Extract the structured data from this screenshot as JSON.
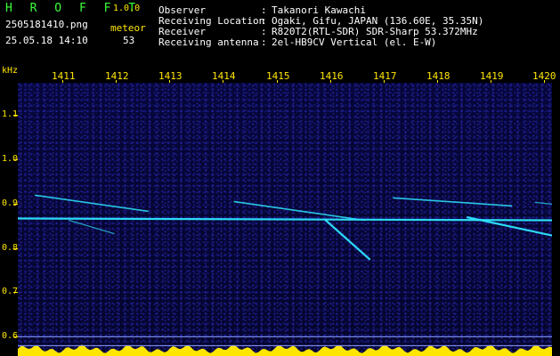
{
  "header": {
    "app_title": "H R O F F T",
    "app_version": "1.0.0",
    "file_name": "2505181410.png",
    "capture_time": "25.05.18 14:10",
    "meteor_label": "meteor",
    "meteor_count": "53"
  },
  "info": [
    {
      "label": "Observer",
      "sep": ":",
      "value": "Takanori Kawachi"
    },
    {
      "label": "Receiving Location",
      "sep": ":",
      "value": "Ogaki, Gifu, JAPAN (136.60E, 35.35N)"
    },
    {
      "label": "Receiver",
      "sep": ":",
      "value": "R820T2(RTL-SDR) SDR-Sharp 53.372MHz"
    },
    {
      "label": "Receiving antenna",
      "sep": ":",
      "value": "2el-HB9CV Vertical (el. E-W)"
    }
  ],
  "colors": {
    "header_green": "#3cff3c",
    "axis_yellow": "#ffe600",
    "background": "#000000",
    "spectrogram_bg": "#06063a",
    "signal_cyan": "#2ee6ff",
    "baseline_line": "#8aa0ff"
  },
  "chart_data": {
    "type": "heatmap",
    "ylabel": "kHz",
    "x_ticks": [
      "1411",
      "1412",
      "1413",
      "1414",
      "1415",
      "1416",
      "1417",
      "1418",
      "1419",
      "1420"
    ],
    "y_ticks": [
      "1.1",
      "1.0",
      "0.9",
      "0.8",
      "0.7",
      "0.6"
    ],
    "x_range": [
      1410.6,
      1420
    ],
    "y_range": [
      0.575,
      1.185
    ],
    "traces": [
      {
        "points": [
          [
            1410.6,
            0.882
          ],
          [
            1420,
            0.878
          ]
        ],
        "intensity": "strong"
      },
      {
        "points": [
          [
            1410.9,
            0.934
          ],
          [
            1412.9,
            0.898
          ]
        ],
        "intensity": "medium"
      },
      {
        "points": [
          [
            1411.5,
            0.878
          ],
          [
            1412.3,
            0.848
          ]
        ],
        "intensity": "weak"
      },
      {
        "points": [
          [
            1414.4,
            0.92
          ],
          [
            1416.7,
            0.878
          ]
        ],
        "intensity": "medium"
      },
      {
        "points": [
          [
            1416.0,
            0.88
          ],
          [
            1416.8,
            0.79
          ]
        ],
        "intensity": "strong"
      },
      {
        "points": [
          [
            1417.2,
            0.928
          ],
          [
            1419.3,
            0.91
          ]
        ],
        "intensity": "medium"
      },
      {
        "points": [
          [
            1418.5,
            0.885
          ],
          [
            1420,
            0.844
          ]
        ],
        "intensity": "strong"
      },
      {
        "points": [
          [
            1419.7,
            0.918
          ],
          [
            1420,
            0.914
          ]
        ],
        "intensity": "weak"
      }
    ],
    "reference_lines": [
      0.618,
      0.598
    ],
    "noise_band": {
      "y_from": 0.575,
      "y_to": 0.6,
      "color": "#ffe600"
    }
  }
}
